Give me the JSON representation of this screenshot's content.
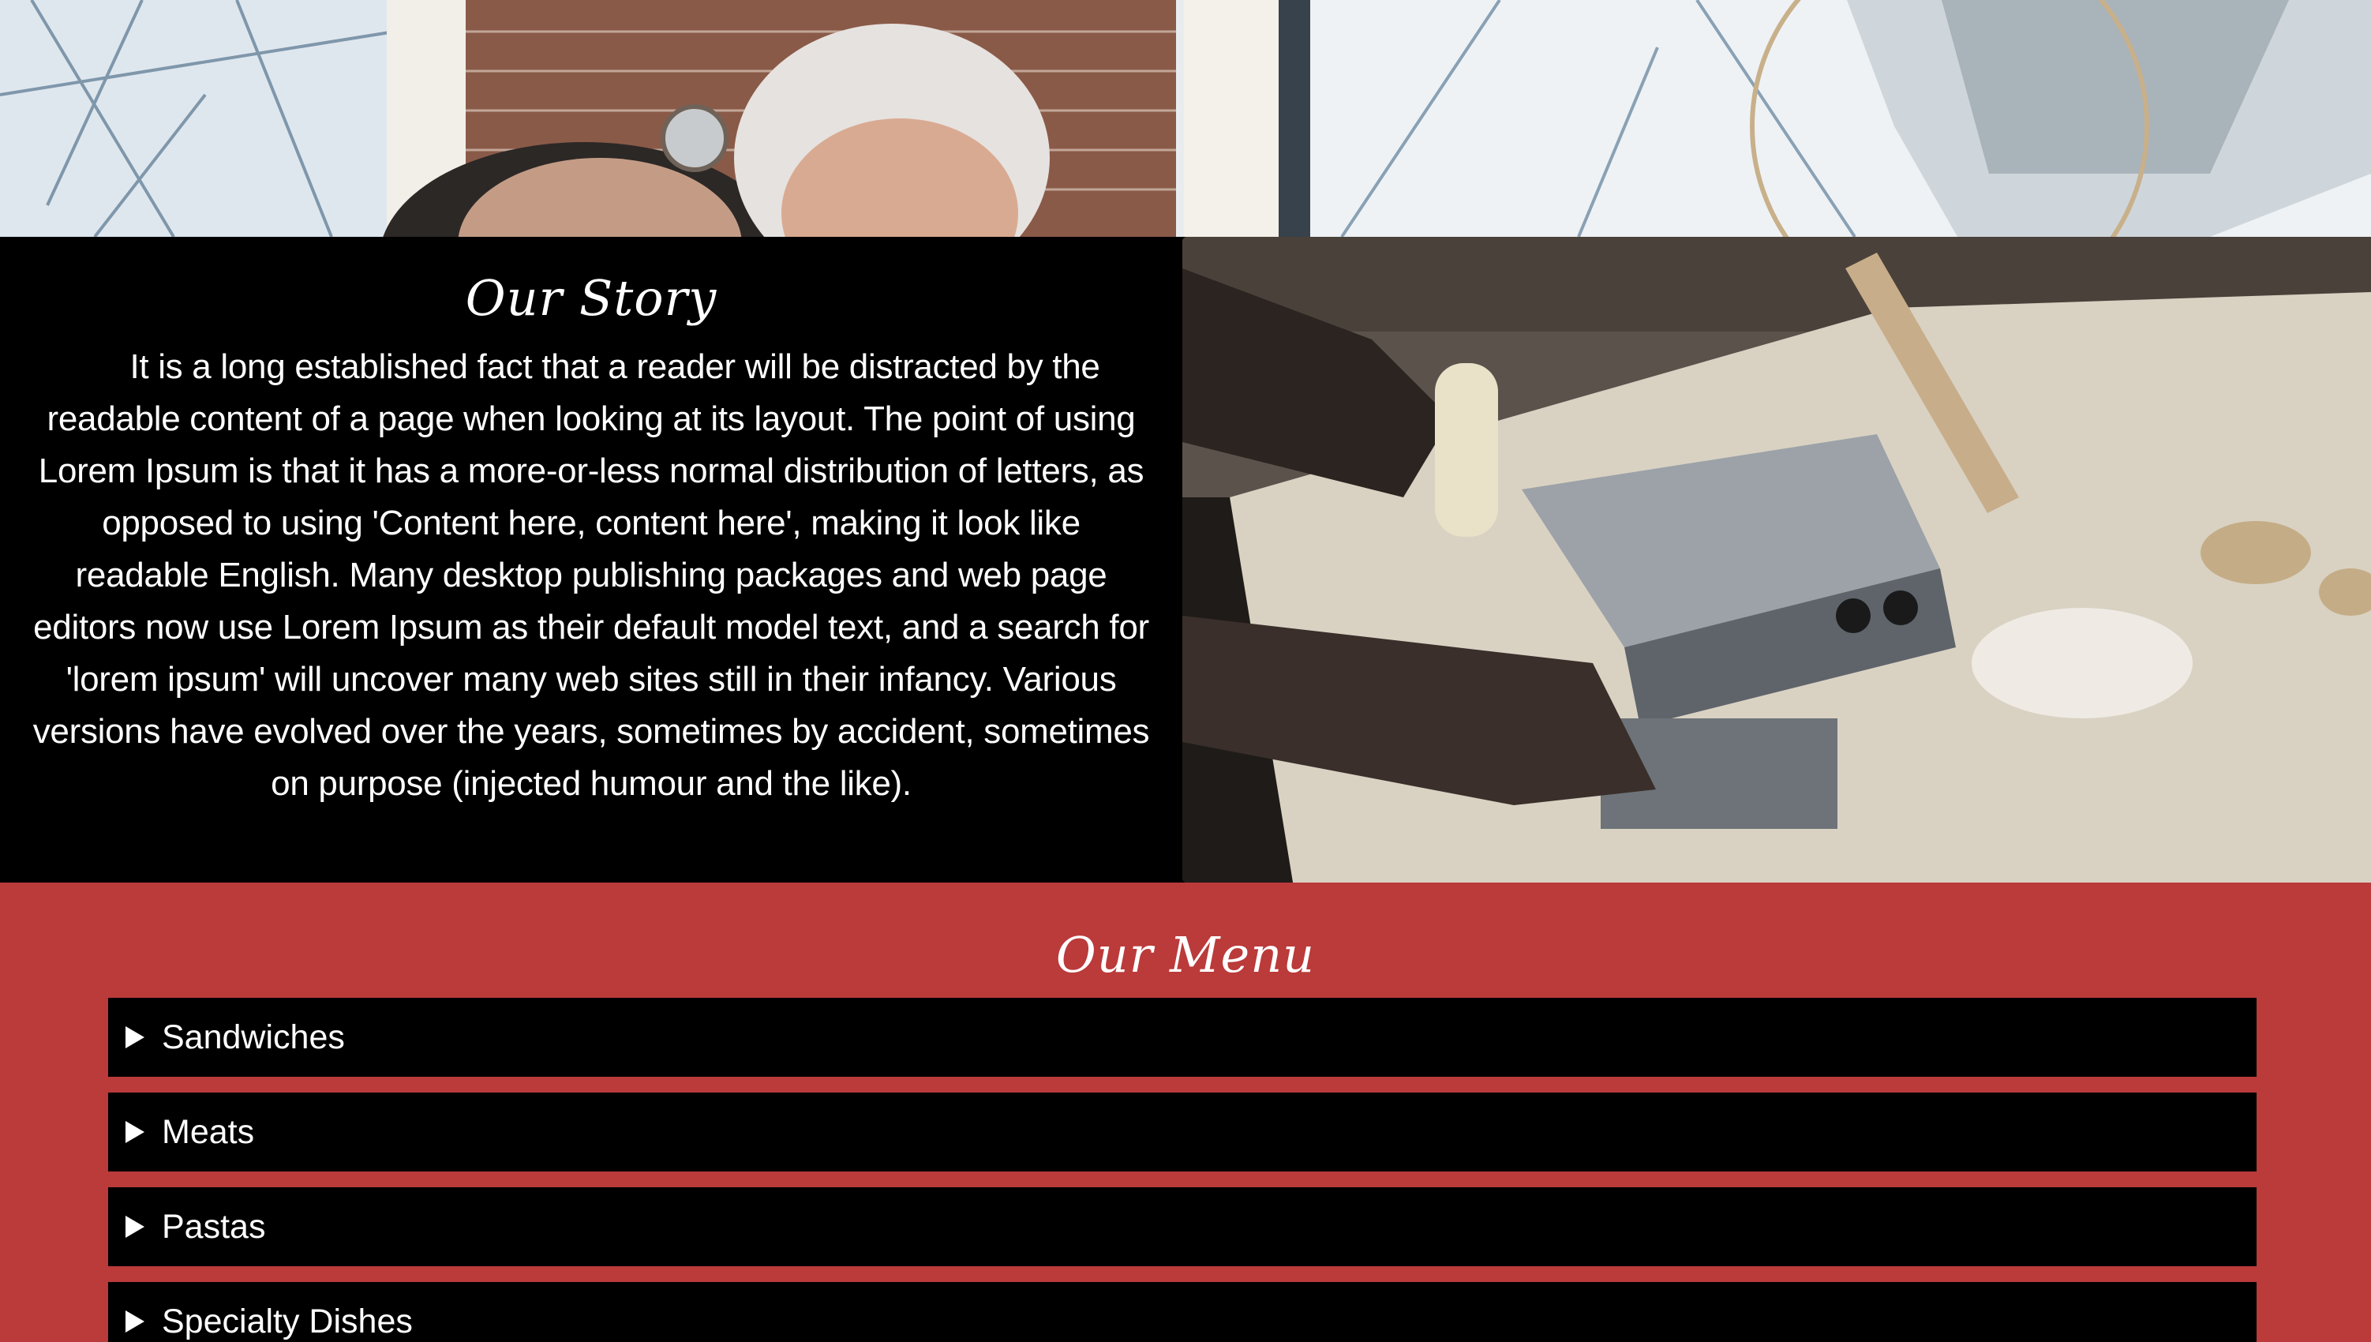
{
  "story": {
    "title": "Our Story",
    "text": "It is a long established fact that a reader will be distracted by the readable content of a page when looking at its layout. The point of using Lorem Ipsum is that it has a more-or-less normal distribution of letters, as opposed to using 'Content here, content here', making it look like readable English. Many desktop publishing packages and web page editors now use Lorem Ipsum as their default model text, and a search for 'lorem ipsum' will uncover many web sites still in their infancy. Various versions have evolved over the years, sometimes by accident, sometimes on purpose (injected humour and the like)."
  },
  "menu": {
    "title": "Our Menu",
    "items": [
      {
        "label": "Sandwiches"
      },
      {
        "label": "Meats"
      },
      {
        "label": "Pastas"
      },
      {
        "label": "Specialty Dishes"
      }
    ]
  },
  "colors": {
    "menu_background": "#bb3a3a",
    "story_background": "#000000",
    "item_background": "#000000",
    "text": "#ffffff"
  },
  "icons": {
    "menu_item_marker": "disclosure-triangle-right-icon"
  }
}
